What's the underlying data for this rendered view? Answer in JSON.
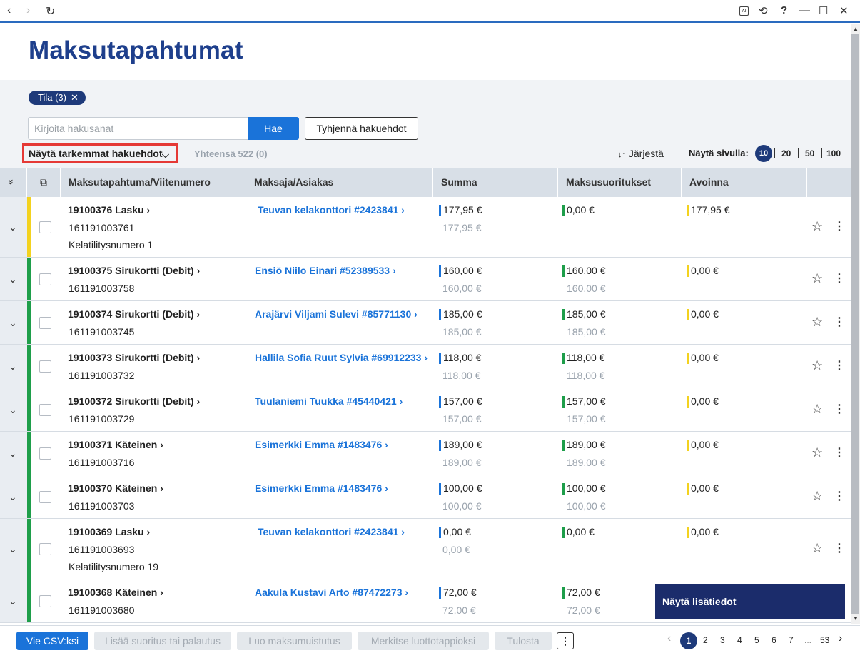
{
  "topbar": {
    "back": "‹",
    "forward": "›",
    "reload": "↻",
    "ai_badge": "AI",
    "history_icon": "⟲",
    "help": "?",
    "minimize": "—",
    "maximize": "☐",
    "close": "✕"
  },
  "page": {
    "title": "Maksutapahtumat"
  },
  "filters": {
    "chip_label": "Tila (3)",
    "chip_close": "✕",
    "search_placeholder": "Kirjoita hakusanat",
    "search_button": "Hae",
    "clear_button": "Tyhjennä hakuehdot",
    "advanced_toggle": "Näytä tarkemmat hakuehdot",
    "advanced_chevron": "⌵",
    "total": "Yhteensä 522 (0)",
    "sort_icon": "↓↑",
    "sort_label": "Järjestä",
    "per_page_label": "Näytä sivulla:",
    "per_page_options": [
      "10",
      "20",
      "50",
      "100"
    ]
  },
  "table": {
    "expand_all_icon": "»",
    "select_all_icon": "⧉",
    "headers": [
      "Maksutapahtuma/Viitenumero",
      "Maksaja/Asiakas",
      "Summa",
      "Maksusuoritukset",
      "Avoinna"
    ],
    "rows": [
      {
        "txn": "19100376 Lasku ›",
        "ref": "161191003761",
        "note": "Kelatilitysnumero 1",
        "payer": "Teuvan kelakonttori #2423841 ›",
        "sum": "177,95 €",
        "sum_sub": "177,95 €",
        "paid": "0,00 €",
        "paid_sub": "",
        "open": "177,95 €",
        "status": "#f3d21f"
      },
      {
        "txn": "19100375 Sirukortti (Debit) ›",
        "ref": "161191003758",
        "note": "",
        "payer": "Ensiö Niilo Einari #52389533 ›",
        "sum": "160,00 €",
        "sum_sub": "160,00 €",
        "paid": "160,00 €",
        "paid_sub": "160,00 €",
        "open": "0,00 €",
        "status": "#1e9e4a"
      },
      {
        "txn": "19100374 Sirukortti (Debit) ›",
        "ref": "161191003745",
        "note": "",
        "payer": "Arajärvi Viljami Sulevi #85771130 ›",
        "sum": "185,00 €",
        "sum_sub": "185,00 €",
        "paid": "185,00 €",
        "paid_sub": "185,00 €",
        "open": "0,00 €",
        "status": "#1e9e4a"
      },
      {
        "txn": "19100373 Sirukortti (Debit) ›",
        "ref": "161191003732",
        "note": "",
        "payer": "Hallila Sofia Ruut Sylvia #69912233 ›",
        "sum": "118,00 €",
        "sum_sub": "118,00 €",
        "paid": "118,00 €",
        "paid_sub": "118,00 €",
        "open": "0,00 €",
        "status": "#1e9e4a"
      },
      {
        "txn": "19100372 Sirukortti (Debit) ›",
        "ref": "161191003729",
        "note": "",
        "payer": "Tuulaniemi Tuukka #45440421 ›",
        "sum": "157,00 €",
        "sum_sub": "157,00 €",
        "paid": "157,00 €",
        "paid_sub": "157,00 €",
        "open": "0,00 €",
        "status": "#1e9e4a"
      },
      {
        "txn": "19100371 Käteinen ›",
        "ref": "161191003716",
        "note": "",
        "payer": "Esimerkki Emma #1483476 ›",
        "sum": "189,00 €",
        "sum_sub": "189,00 €",
        "paid": "189,00 €",
        "paid_sub": "189,00 €",
        "open": "0,00 €",
        "status": "#1e9e4a"
      },
      {
        "txn": "19100370 Käteinen ›",
        "ref": "161191003703",
        "note": "",
        "payer": "Esimerkki Emma #1483476 ›",
        "sum": "100,00 €",
        "sum_sub": "100,00 €",
        "paid": "100,00 €",
        "paid_sub": "100,00 €",
        "open": "0,00 €",
        "status": "#1e9e4a"
      },
      {
        "txn": "19100369 Lasku ›",
        "ref": "161191003693",
        "note": "Kelatilitysnumero 19",
        "payer": "Teuvan kelakonttori #2423841 ›",
        "sum": "0,00 €",
        "sum_sub": "0,00 €",
        "paid": "0,00 €",
        "paid_sub": "",
        "open": "0,00 €",
        "status": "#1e9e4a"
      },
      {
        "txn": "19100368 Käteinen ›",
        "ref": "161191003680",
        "note": "",
        "payer": "Aakula Kustavi Arto #87472273 ›",
        "sum": "72,00 €",
        "sum_sub": "72,00 €",
        "paid": "72,00 €",
        "paid_sub": "72,00 €",
        "open": "",
        "status": "#1e9e4a"
      }
    ],
    "row_expand_icon": "⌄",
    "star_icon": "☆",
    "more_icon": "⋮",
    "details_button": "Näytä lisätiedot"
  },
  "bottom": {
    "export_csv": "Vie CSV:ksi",
    "add_payment": "Lisää suoritus tai palautus",
    "create_reminder": "Luo maksumuistutus",
    "mark_credit_loss": "Merkitse luottotappioksi",
    "print": "Tulosta",
    "more": "⋮",
    "prev": "‹",
    "next": "›",
    "pages": [
      "1",
      "2",
      "3",
      "4",
      "5",
      "6",
      "7"
    ],
    "ellipsis": "...",
    "last_page": "53"
  },
  "colors": {
    "accent": "#1a73d9",
    "navy": "#1e3a7a",
    "title": "#1e3f8c",
    "green": "#1e9e4a",
    "yellow": "#f3d21f"
  }
}
